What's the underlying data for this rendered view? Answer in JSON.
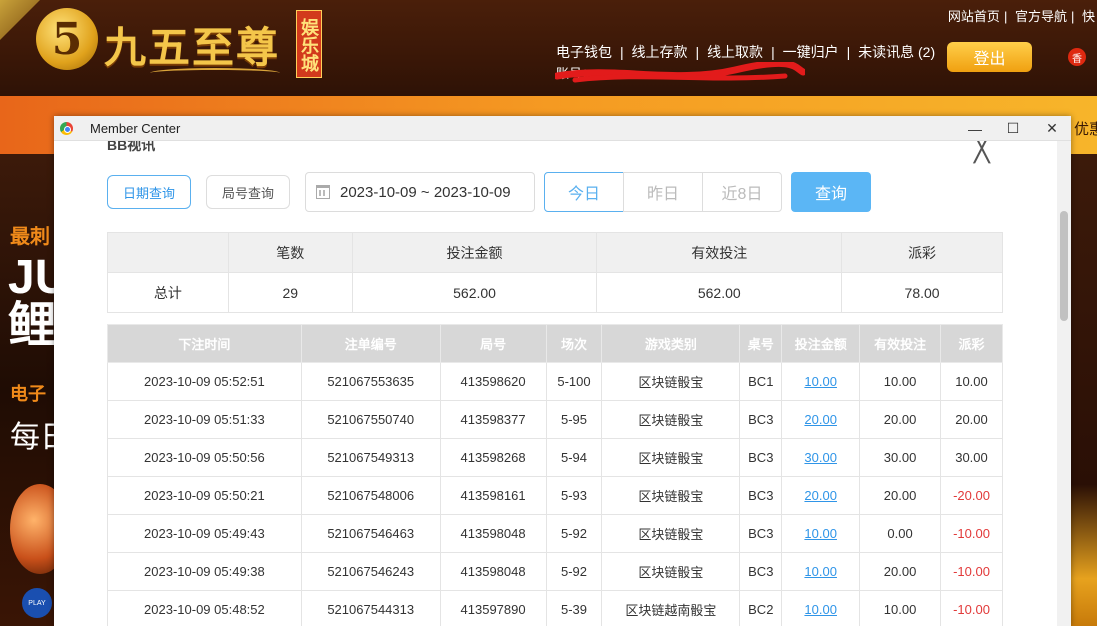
{
  "site": {
    "logo_digit": "5",
    "logo_name": "九五至尊",
    "logo_badge": "娱乐城",
    "top_links": [
      "网站首页",
      "官方导航",
      "快"
    ],
    "nav_links": [
      "电子钱包",
      "线上存款",
      "线上取款",
      "一键归户",
      "未读讯息 (2)"
    ],
    "account_label": "账号：",
    "logout": "登出",
    "flag": "香",
    "promo_right": "优惠",
    "left_banner": {
      "line1": "最刺",
      "line2": "JU",
      "line2b": "鲤",
      "line3": "电子",
      "line4": "每日",
      "badge": "PLAY"
    },
    "accent_orange": "#f59a22",
    "header_brown": "#3a1707"
  },
  "window": {
    "title": "Member Center",
    "min": "—",
    "max": "☐",
    "close": "✕"
  },
  "panel": {
    "section_title": "BB视讯",
    "close": "╳",
    "tabs": {
      "by_date": "日期查询",
      "by_round": "局号查询"
    },
    "date_range": "2023-10-09 ~ 2023-10-09",
    "ranges": {
      "today": "今日",
      "yesterday": "昨日",
      "last8": "近8日"
    },
    "query": "查询",
    "accent_blue": "#5bb6f5"
  },
  "summary": {
    "headers": [
      "",
      "笔数",
      "投注金额",
      "有效投注",
      "派彩"
    ],
    "row": [
      "总计",
      "29",
      "562.00",
      "562.00",
      "78.00"
    ]
  },
  "detail": {
    "headers": [
      "下注时间",
      "注单编号",
      "局号",
      "场次",
      "游戏类别",
      "桌号",
      "投注金额",
      "有效投注",
      "派彩"
    ],
    "rows": [
      [
        "2023-10-09 05:52:51",
        "521067553635",
        "413598620",
        "5-100",
        "区块链骰宝",
        "BC1",
        "10.00",
        "10.00",
        "10.00"
      ],
      [
        "2023-10-09 05:51:33",
        "521067550740",
        "413598377",
        "5-95",
        "区块链骰宝",
        "BC3",
        "20.00",
        "20.00",
        "20.00"
      ],
      [
        "2023-10-09 05:50:56",
        "521067549313",
        "413598268",
        "5-94",
        "区块链骰宝",
        "BC3",
        "30.00",
        "30.00",
        "30.00"
      ],
      [
        "2023-10-09 05:50:21",
        "521067548006",
        "413598161",
        "5-93",
        "区块链骰宝",
        "BC3",
        "20.00",
        "20.00",
        "-20.00"
      ],
      [
        "2023-10-09 05:49:43",
        "521067546463",
        "413598048",
        "5-92",
        "区块链骰宝",
        "BC3",
        "10.00",
        "0.00",
        "-10.00"
      ],
      [
        "2023-10-09 05:49:38",
        "521067546243",
        "413598048",
        "5-92",
        "区块链骰宝",
        "BC3",
        "10.00",
        "20.00",
        "-10.00"
      ],
      [
        "2023-10-09 05:48:52",
        "521067544313",
        "413597890",
        "5-39",
        "区块链越南骰宝",
        "BC2",
        "10.00",
        "10.00",
        "-10.00"
      ]
    ]
  }
}
